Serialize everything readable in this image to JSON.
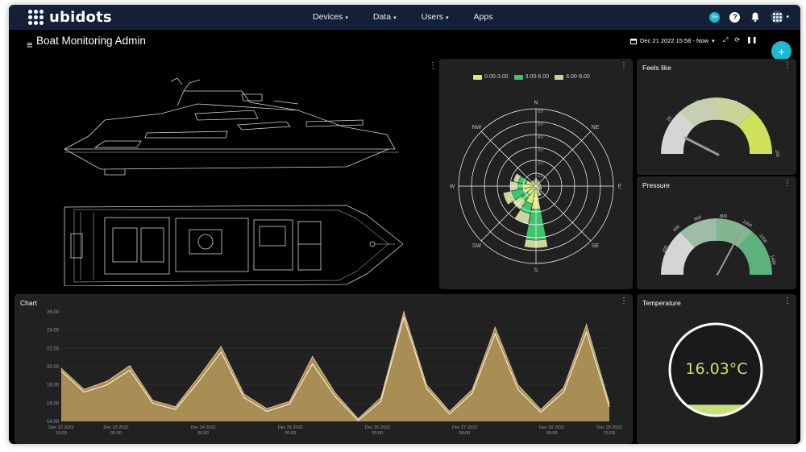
{
  "app": {
    "brand": "ubidots"
  },
  "nav": [
    {
      "label": "Devices",
      "dropdown": true
    },
    {
      "label": "Data",
      "dropdown": true
    },
    {
      "label": "Users",
      "dropdown": true
    },
    {
      "label": "Apps",
      "dropdown": false
    }
  ],
  "topbar": {
    "notification_count": "9+",
    "help_label": "?"
  },
  "dashboard": {
    "title": "Boat Monitoring Admin",
    "date_range": "Dec 21 2022 15:58 - Now",
    "add_label": "+"
  },
  "colors": {
    "accent": "#20b9d0",
    "navbar": "#142038",
    "widget": "#212121",
    "area_fill": "#a88d55",
    "area_line": "#f3ead2"
  },
  "wind_rose": {
    "legend": [
      {
        "label": "0.00-3.00",
        "color": "#dde87a"
      },
      {
        "label": "3.00-6.00",
        "color": "#3ec46e"
      },
      {
        "label": "6.00-9.00",
        "color": "#c9d79b"
      }
    ],
    "directions": [
      "N",
      "NE",
      "E",
      "SE",
      "S",
      "SW",
      "W",
      "NW"
    ],
    "rings": [
      "10",
      "20",
      "30",
      "40",
      "50",
      "60"
    ],
    "max": 60
  },
  "feels_like": {
    "title": "Feels like",
    "ticks": [
      "0",
      "20",
      "40",
      "60",
      "80",
      "100"
    ],
    "value": 33
  },
  "pressure": {
    "title": "Pressure",
    "ticks": [
      "200",
      "400",
      "600",
      "800",
      "1000",
      "1200",
      "1400"
    ],
    "value": 1000
  },
  "chart": {
    "title": "Chart",
    "y_ticks": [
      "14.00",
      "16.00",
      "18.00",
      "20.00",
      "22.00",
      "24.00",
      "26.00"
    ],
    "x_labels": [
      [
        "Dec 22 2022",
        "10:03"
      ],
      [
        "Dec 23 2022",
        "00:00"
      ],
      [
        "Dec 24 2022",
        "00:00"
      ],
      [
        "Dec 25 2022",
        "00:00"
      ],
      [
        "Dec 26 2022",
        "00:00"
      ],
      [
        "Dec 27 2022",
        "00:00"
      ],
      [
        "Dec 28 2022",
        "00:00"
      ],
      [
        "Dec 28 2022",
        "15:03"
      ]
    ]
  },
  "temperature": {
    "title": "Temperature",
    "display": "16.03°C",
    "level": 0.12
  },
  "chart_data": {
    "type": "area",
    "xlabel": "",
    "ylabel": "",
    "ylim": [
      14,
      26
    ],
    "x": [
      "Dec 22 2022 10:03",
      "Dec 22 2022 16:00",
      "Dec 23 2022 00:00",
      "Dec 23 2022 08:00",
      "Dec 23 2022 14:00",
      "Dec 24 2022 00:00",
      "Dec 24 2022 06:00",
      "Dec 24 2022 12:00",
      "Dec 24 2022 16:00",
      "Dec 25 2022 00:00",
      "Dec 25 2022 06:00",
      "Dec 25 2022 12:00",
      "Dec 25 2022 16:00",
      "Dec 26 2022 00:00",
      "Dec 26 2022 06:00",
      "Dec 26 2022 12:00",
      "Dec 26 2022 16:00",
      "Dec 27 2022 00:00",
      "Dec 27 2022 06:00",
      "Dec 27 2022 12:00",
      "Dec 27 2022 16:00",
      "Dec 28 2022 00:00",
      "Dec 28 2022 06:00",
      "Dec 28 2022 12:00",
      "Dec 28 2022 15:03"
    ],
    "series": [
      {
        "values": [
          19.8,
          17.5,
          18.4,
          20.1,
          16.3,
          15.6,
          18.8,
          22.2,
          17.0,
          15.4,
          16.2,
          21.1,
          17.1,
          14.3,
          16.6,
          26.0,
          18.0,
          15.1,
          17.5,
          24.3,
          18.0,
          15.3,
          17.7,
          24.6,
          16.0
        ]
      },
      {
        "values": [
          19.5,
          17.2,
          18.0,
          19.6,
          16.0,
          15.3,
          18.3,
          21.6,
          16.6,
          15.1,
          15.9,
          20.3,
          16.7,
          14.1,
          16.2,
          25.4,
          17.6,
          14.8,
          17.1,
          23.6,
          17.5,
          15.0,
          17.2,
          23.8,
          15.6
        ]
      }
    ]
  }
}
